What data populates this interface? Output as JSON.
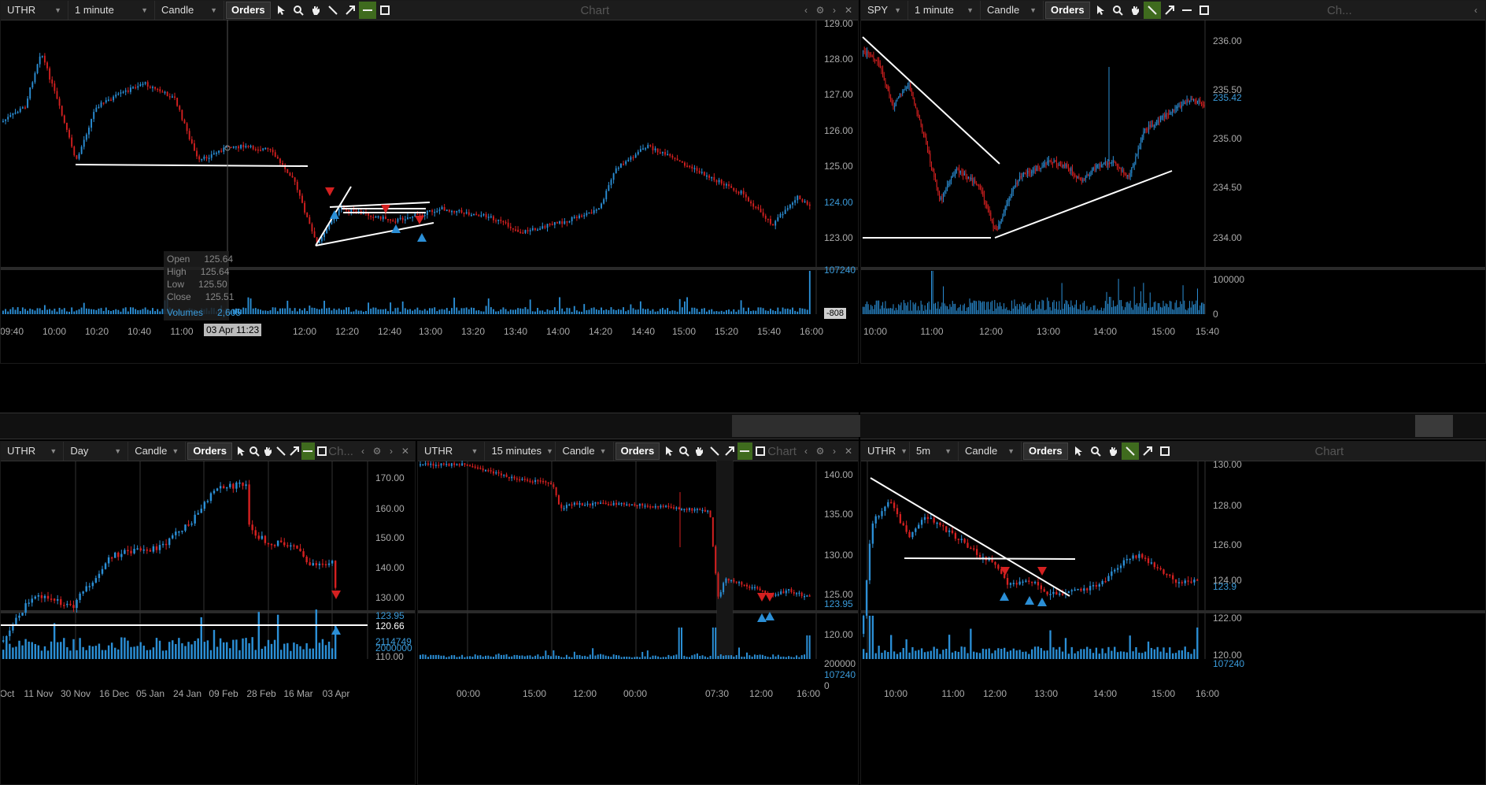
{
  "colors": {
    "up": "#2b8fd6",
    "down": "#d42020",
    "line": "#ffffff",
    "bg": "#000000",
    "toolbar": "#1c1c1c"
  },
  "panels": [
    {
      "symbol": "UTHR",
      "interval": "1 minute",
      "style": "Candle",
      "orders": "Orders",
      "title": "Chart",
      "yticks": [
        "129.00",
        "128.00",
        "127.00",
        "126.00",
        "125.00",
        "124.00",
        "123.00"
      ],
      "last_price": "124.06",
      "vol_max": "107240",
      "vol_min": "-808",
      "xticks": [
        "09:40",
        "10:00",
        "10:20",
        "10:40",
        "11:00",
        "03 Apr 11:23",
        "12:00",
        "12:20",
        "12:40",
        "13:00",
        "13:20",
        "13:40",
        "14:00",
        "14:20",
        "14:40",
        "15:00",
        "15:20",
        "15:40",
        "16:00"
      ],
      "ohlc": {
        "open_label": "Open",
        "open": "125.64",
        "high_label": "High",
        "high": "125.64",
        "low_label": "Low",
        "low": "125.50",
        "close_label": "Close",
        "close": "125.51",
        "vol_label": "Volumes",
        "vol": "2,605"
      }
    },
    {
      "symbol": "SPY",
      "interval": "1 minute",
      "style": "Candle",
      "orders": "Orders",
      "title": "Ch...",
      "yticks": [
        "236.00",
        "235.50",
        "235.42",
        "235.00",
        "234.50",
        "234.00"
      ],
      "vol_max": "100000",
      "vol_min": "0",
      "xticks": [
        "10:00",
        "11:00",
        "12:00",
        "13:00",
        "14:00",
        "15:00",
        "15:40"
      ]
    },
    {
      "symbol": "UTHR",
      "interval": "Day",
      "style": "Candle",
      "orders": "Orders",
      "title": "Ch...",
      "yticks": [
        "170.00",
        "160.00",
        "150.00",
        "140.00",
        "130.00",
        "123.95",
        "120.66",
        "110.00"
      ],
      "vol_max": "2114749",
      "vol_max2": "2000000",
      "xticks": [
        "Oct",
        "11 Nov",
        "30 Nov",
        "16 Dec",
        "05 Jan",
        "24 Jan",
        "09 Feb",
        "28 Feb",
        "16 Mar",
        "03 Apr"
      ]
    },
    {
      "symbol": "UTHR",
      "interval": "15 minutes",
      "style": "Candle",
      "orders": "Orders",
      "title": "Chart",
      "yticks": [
        "140.00",
        "135.00",
        "130.00",
        "125.00",
        "123.95",
        "120.00"
      ],
      "vol_max": "200000",
      "vol_mid": "107240",
      "vol_min": "0",
      "xticks": [
        "00:00",
        "15:00",
        "12:00",
        "00:00",
        "07:30",
        "12:00",
        "16:00"
      ]
    },
    {
      "symbol": "UTHR",
      "interval": "5m",
      "style": "Candle",
      "orders": "Orders",
      "title": "Chart",
      "yticks": [
        "130.00",
        "128.00",
        "126.00",
        "124.00",
        "123.9",
        "122.00",
        "120.00"
      ],
      "vol_max": "107240",
      "xticks": [
        "10:00",
        "11:00",
        "12:00",
        "13:00",
        "14:00",
        "15:00",
        "16:00"
      ]
    }
  ]
}
